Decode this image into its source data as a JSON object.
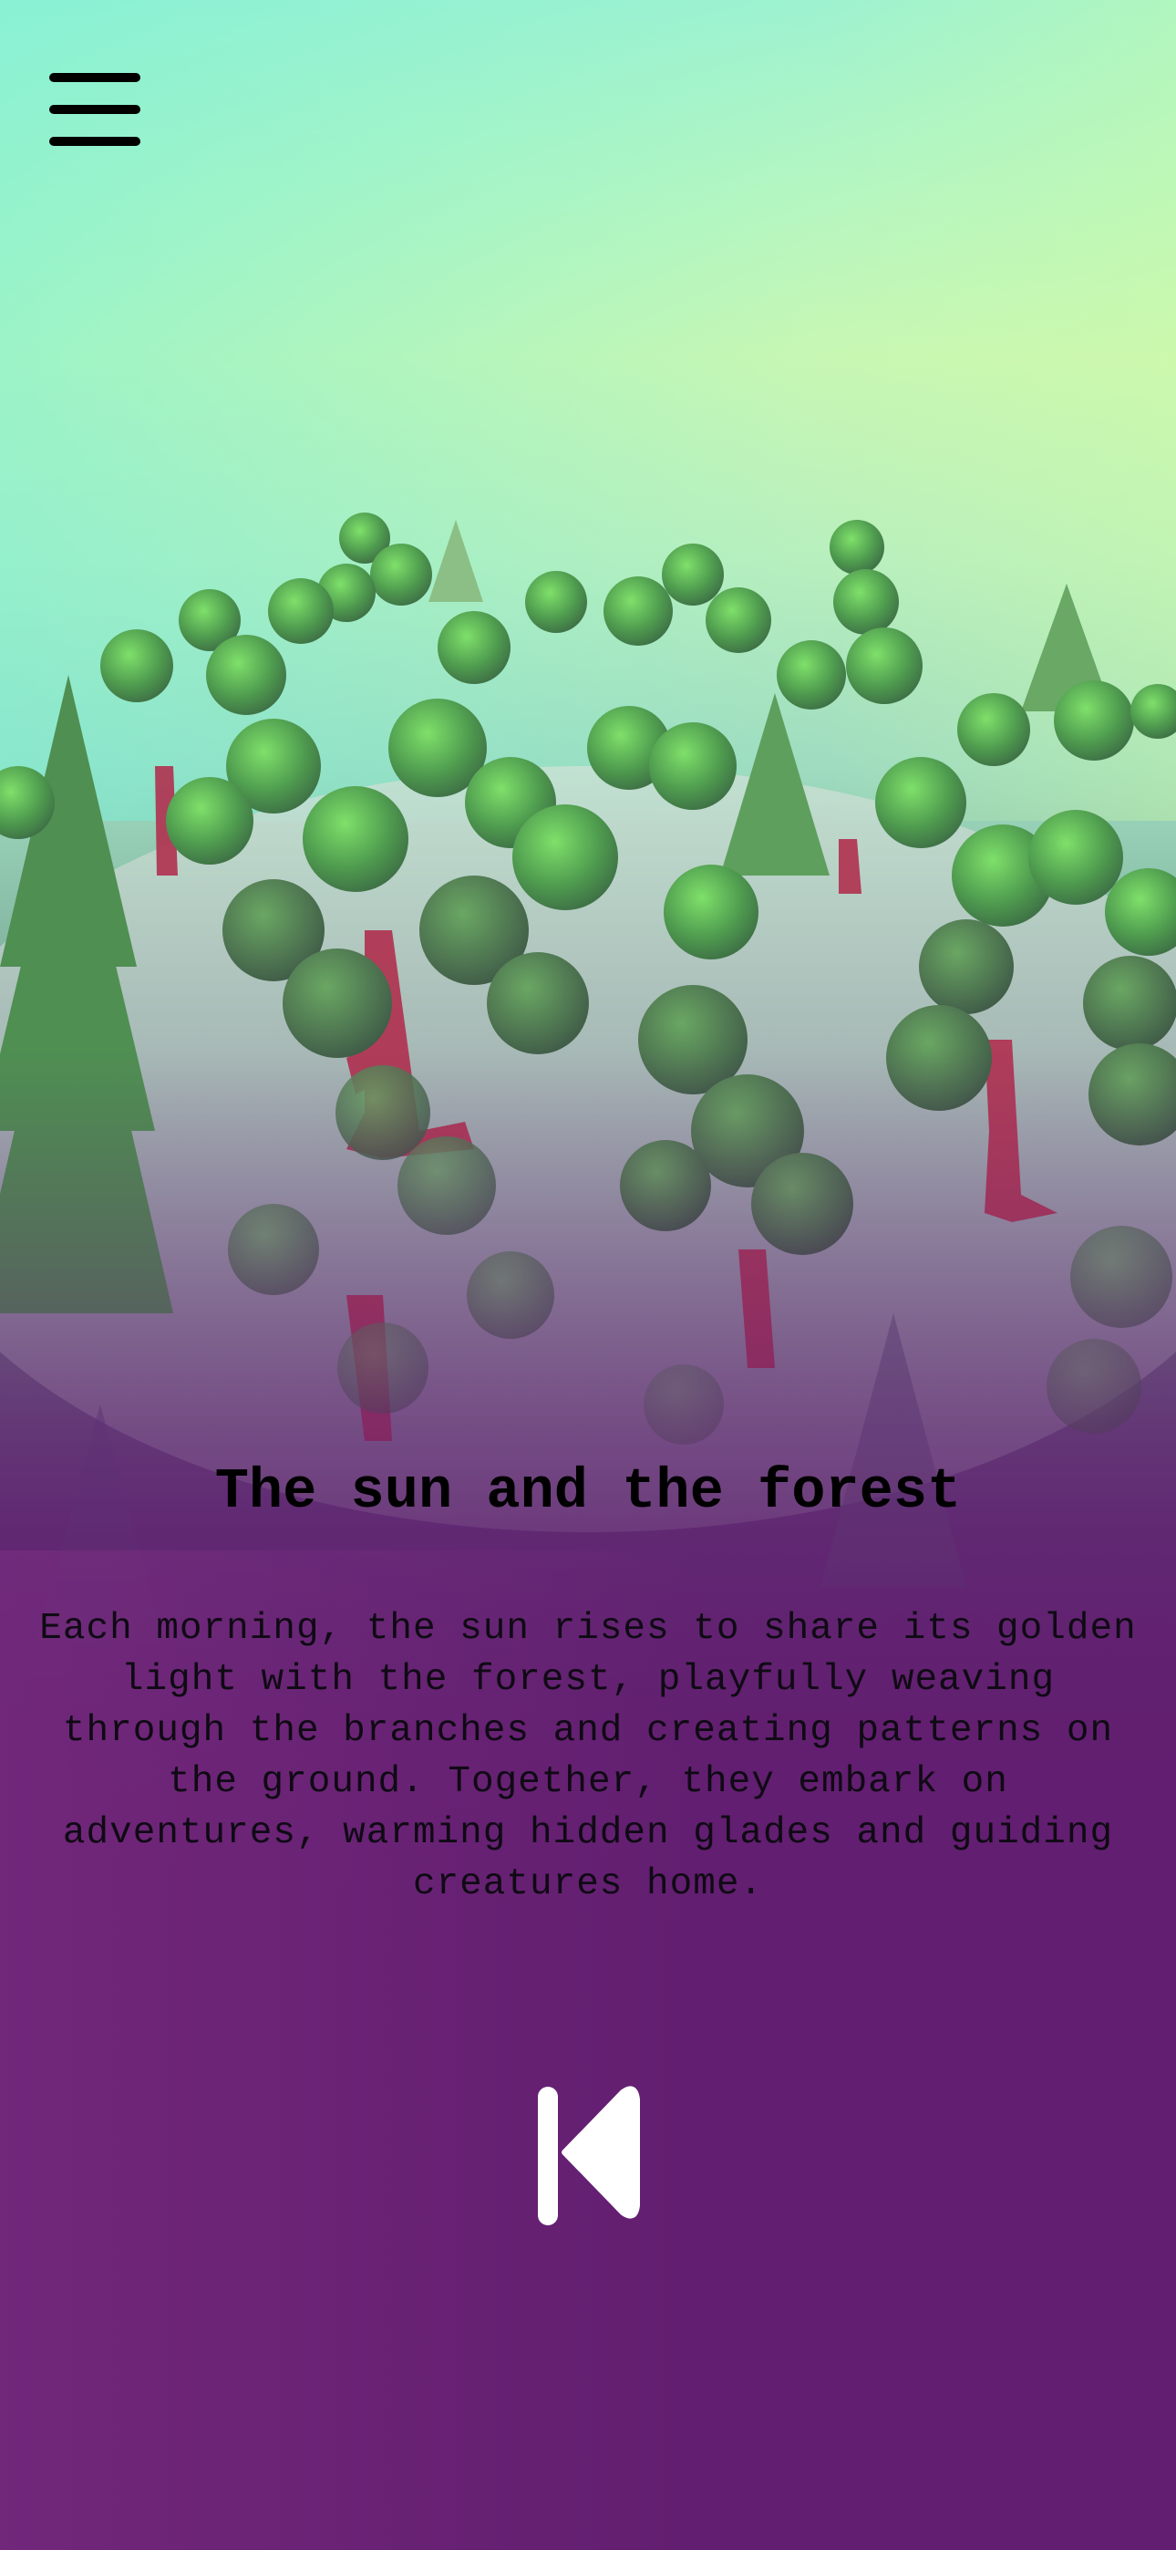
{
  "app": {
    "menu_icon": "hamburger-menu-icon"
  },
  "story": {
    "title": "The sun and the forest",
    "body": "Each morning, the sun rises to share its golden light with the forest, playfully weaving through the branches and creating patterns on the ground. Together, they embark on adventures, warming hidden glades and guiding creatures home."
  },
  "controls": {
    "previous_icon": "skip-previous-icon"
  },
  "colors": {
    "sky_top": "#9ef2d0",
    "sky_right": "#c8f7b3",
    "foliage": "#5fae5a",
    "trunk": "#b0304f",
    "background_bottom": "#611f70",
    "text": "#000000",
    "icon_light": "#ffffff"
  }
}
